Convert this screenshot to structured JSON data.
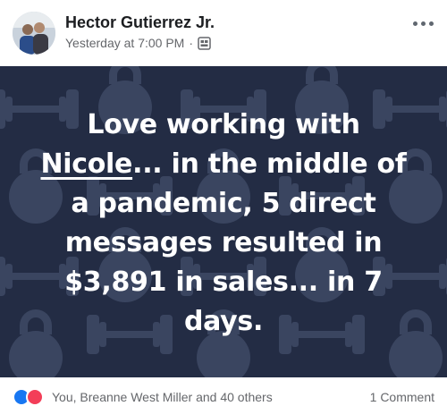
{
  "post": {
    "author": "Hector Gutierrez Jr.",
    "timestamp": "Yesterday at 7:00 PM",
    "separator": "·",
    "privacy_icon": "friends-icon",
    "more_icon": "more-options-icon"
  },
  "image": {
    "background_color": "#232c44",
    "pattern_color": "#3a4560",
    "pattern_icons": [
      "kettlebell-icon",
      "dumbbell-icon"
    ],
    "mention": "Nicole",
    "text_line1": "Love working with",
    "text_after_mention": "... in the middle of",
    "text_line3": "a pandemic, 5 direct",
    "text_line4": "messages resulted in",
    "text_line5": "$3,891 in sales... in 7",
    "text_line6": "days."
  },
  "footer": {
    "reaction_icons": [
      "like-icon",
      "love-icon"
    ],
    "reactions_text": "You, Breanne West Miller and 40 others",
    "comments": "1 Comment"
  },
  "colors": {
    "like": "#1877f2",
    "love": "#f33e58",
    "text_secondary": "#65676b"
  }
}
